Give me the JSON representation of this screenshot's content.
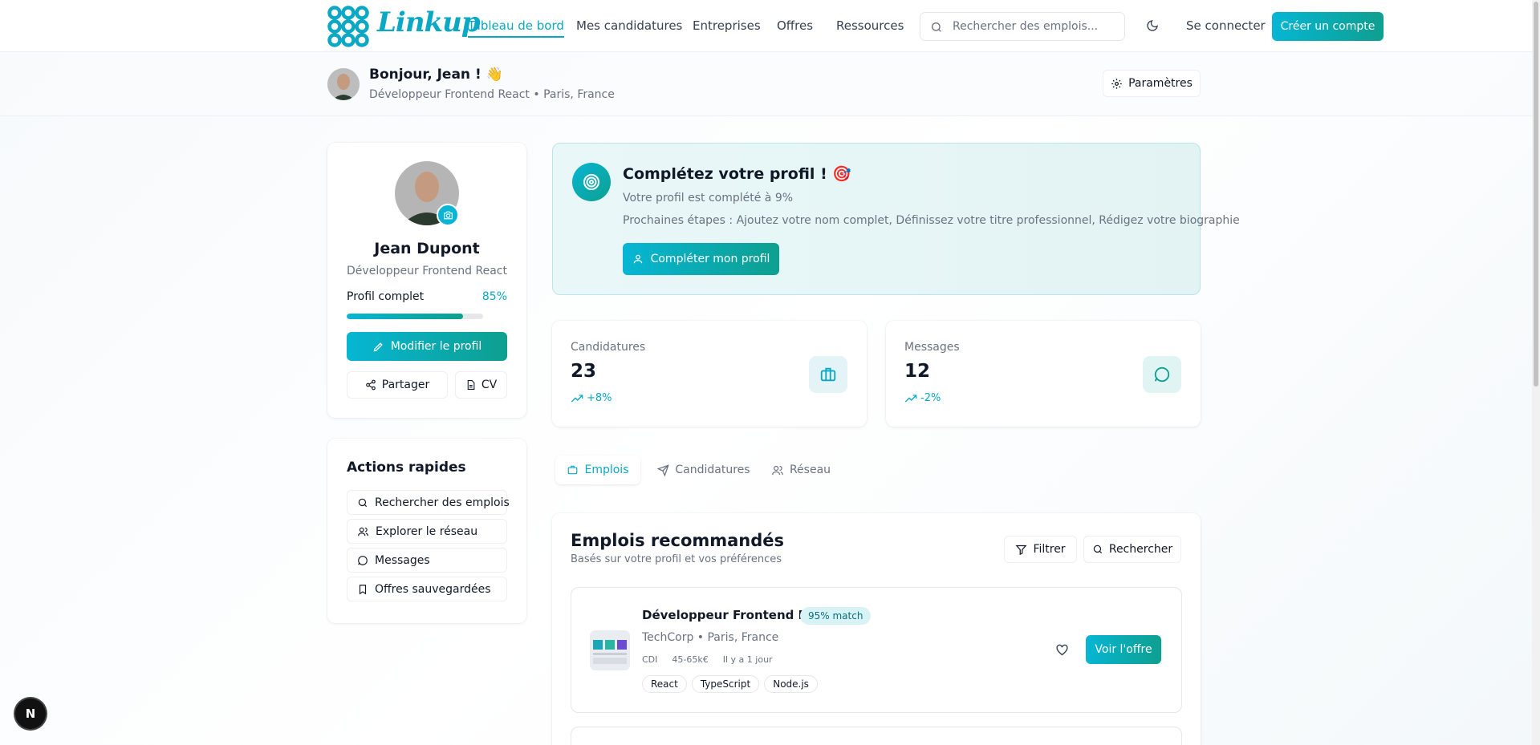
{
  "header": {
    "brand": "Linkup",
    "nav": [
      {
        "label": "Tableau de bord",
        "active": true
      },
      {
        "label": "Mes candidatures"
      },
      {
        "label": "Entreprises"
      },
      {
        "label": "Offres"
      },
      {
        "label": "Ressources"
      }
    ],
    "search_placeholder": "Rechercher des emplois...",
    "theme_icon": "moon-icon",
    "login": "Se connecter",
    "signup": "Créer un compte"
  },
  "greeting": {
    "title": "Bonjour, Jean ! 👋",
    "subtitle": "Développeur Frontend React • Paris, France",
    "settings": "Paramètres"
  },
  "profile_card": {
    "name": "Jean Dupont",
    "role": "Développeur Frontend React",
    "progress_label": "Profil complet",
    "progress_value": "85%",
    "progress_fraction": 0.85,
    "edit": "Modifier le profil",
    "share": "Partager",
    "cv": "CV"
  },
  "quick_actions": {
    "title": "Actions rapides",
    "items": [
      {
        "label": "Rechercher des emplois",
        "icon": "search-icon"
      },
      {
        "label": "Explorer le réseau",
        "icon": "users-icon"
      },
      {
        "label": "Messages",
        "icon": "message-icon"
      },
      {
        "label": "Offres sauvegardées",
        "icon": "bookmark-icon"
      }
    ]
  },
  "complete_banner": {
    "title": "Complétez votre profil ! 🎯",
    "status": "Votre profil est complété à 9%",
    "next_steps": "Prochaines étapes : Ajoutez votre nom complet, Définissez votre titre professionnel, Rédigez votre biographie",
    "button": "Compléter mon profil"
  },
  "stats": [
    {
      "label": "Candidatures",
      "value": "23",
      "trend": "+8%",
      "icon": "briefcase-icon"
    },
    {
      "label": "Messages",
      "value": "12",
      "trend": "-2%",
      "icon": "message-icon"
    }
  ],
  "tabs": [
    {
      "label": "Emplois",
      "active": true,
      "icon": "briefcase-icon"
    },
    {
      "label": "Candidatures",
      "icon": "send-icon"
    },
    {
      "label": "Réseau",
      "icon": "users-icon"
    }
  ],
  "jobs_section": {
    "title": "Emplois recommandés",
    "subtitle": "Basés sur votre profil et vos préférences",
    "filter": "Filtrer",
    "search": "Rechercher",
    "jobs": [
      {
        "title": "Développeur Frontend React",
        "match": "95% match",
        "company": "TechCorp • Paris, France",
        "contract": "CDI",
        "salary": "45-65k€",
        "posted": "Il y a 1 jour",
        "tags": [
          "React",
          "TypeScript",
          "Node.js"
        ],
        "cta": "Voir l'offre"
      }
    ]
  },
  "floating_badge": "N",
  "colors": {
    "accent": "#0aa8c4",
    "accent2": "#0e9f8f"
  }
}
